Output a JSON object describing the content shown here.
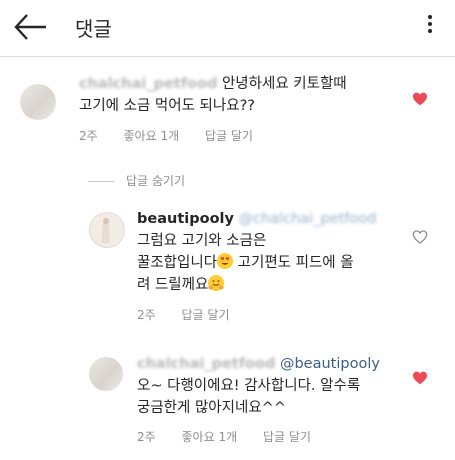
{
  "header": {
    "title": "댓글"
  },
  "comments": [
    {
      "username": "chalchai_petfood",
      "text1": "안녕하세요 키토할때",
      "text2": "고기에 소금 먹어도 되나요??",
      "time": "2주",
      "likes": "좋아요 1개",
      "reply": "답글 달기",
      "liked": true
    }
  ],
  "hide_replies_label": "답글 숨기기",
  "replies": [
    {
      "username": "beautipooly",
      "mention": "@chalchai_petfood",
      "line1": "그럼요 고기와 소금은",
      "line2a": "꿀조합입니다",
      "line2b": " 고기편도 피드에 올",
      "line3": "려 드릴께요",
      "time": "2주",
      "reply": "답글 달기",
      "liked": false
    },
    {
      "username": "chalchai_petfood",
      "mention": "@beautipooly",
      "line1": "오~ 다행이에요! 감사합니다.  알수록",
      "line2": "궁금한게 많아지네요^^",
      "time": "2주",
      "likes": "좋아요 1개",
      "reply": "답글 달기",
      "liked": true
    }
  ],
  "colors": {
    "heart_liked": "#ed4956",
    "link": "#3b5e88",
    "meta": "#8e8e8e"
  }
}
